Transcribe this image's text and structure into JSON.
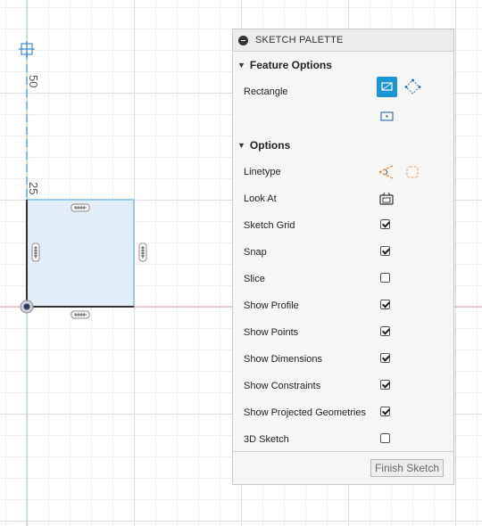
{
  "canvas": {
    "axis_labels": [
      "50",
      "25"
    ]
  },
  "palette": {
    "title": "SKETCH PALETTE",
    "feature_options": {
      "heading": "Feature Options",
      "rectangle_label": "Rectangle",
      "rectangle_modes": [
        "two-point-rectangle-icon",
        "three-point-rectangle-icon",
        "center-rectangle-icon"
      ],
      "selected_mode": "two-point-rectangle-icon"
    },
    "options": {
      "heading": "Options",
      "linetype_label": "Linetype",
      "look_at_label": "Look At",
      "toggles": [
        {
          "label": "Sketch Grid",
          "checked": true
        },
        {
          "label": "Snap",
          "checked": true
        },
        {
          "label": "Slice",
          "checked": false
        },
        {
          "label": "Show Profile",
          "checked": true
        },
        {
          "label": "Show Points",
          "checked": true
        },
        {
          "label": "Show Dimensions",
          "checked": true
        },
        {
          "label": "Show Constraints",
          "checked": true
        },
        {
          "label": "Show Projected Geometries",
          "checked": true
        },
        {
          "label": "3D Sketch",
          "checked": false
        }
      ]
    },
    "finish_label": "Finish Sketch"
  },
  "colors": {
    "accent": "#1a96d5",
    "profile_fill": "#dceaf7",
    "profile_edge": "#7cb8e0",
    "x_axis": "#e09a9a",
    "y_axis": "#9ed39e"
  }
}
